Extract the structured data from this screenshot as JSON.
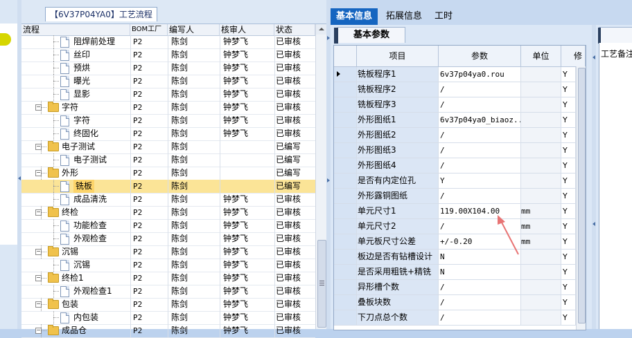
{
  "tree_panel": {
    "title": "【6V37P04YA0】工艺流程",
    "columns": {
      "flow": "流程",
      "bom": "BOM工厂",
      "writer": "编写人",
      "reviewer": "核审人",
      "status": "状态"
    },
    "rows": [
      {
        "level": 2,
        "type": "doc",
        "name": "阻焊前处理",
        "bom": "P2",
        "writer": "陈剑",
        "reviewer": "钟梦飞",
        "status": "已审核"
      },
      {
        "level": 2,
        "type": "doc",
        "name": "丝印",
        "bom": "P2",
        "writer": "陈剑",
        "reviewer": "钟梦飞",
        "status": "已审核"
      },
      {
        "level": 2,
        "type": "doc",
        "name": "预烘",
        "bom": "P2",
        "writer": "陈剑",
        "reviewer": "钟梦飞",
        "status": "已审核"
      },
      {
        "level": 2,
        "type": "doc",
        "name": "曝光",
        "bom": "P2",
        "writer": "陈剑",
        "reviewer": "钟梦飞",
        "status": "已审核"
      },
      {
        "level": 2,
        "type": "doc",
        "name": "显影",
        "bom": "P2",
        "writer": "陈剑",
        "reviewer": "钟梦飞",
        "status": "已审核"
      },
      {
        "level": 1,
        "type": "folder",
        "name": "字符",
        "bom": "P2",
        "writer": "陈剑",
        "reviewer": "钟梦飞",
        "status": "已审核"
      },
      {
        "level": 2,
        "type": "doc",
        "name": "字符",
        "bom": "P2",
        "writer": "陈剑",
        "reviewer": "钟梦飞",
        "status": "已审核"
      },
      {
        "level": 2,
        "type": "doc",
        "name": "终固化",
        "bom": "P2",
        "writer": "陈剑",
        "reviewer": "钟梦飞",
        "status": "已审核"
      },
      {
        "level": 1,
        "type": "folder",
        "name": "电子测试",
        "bom": "P2",
        "writer": "陈剑",
        "reviewer": "",
        "status": "已编写"
      },
      {
        "level": 2,
        "type": "doc",
        "name": "电子测试",
        "bom": "P2",
        "writer": "陈剑",
        "reviewer": "",
        "status": "已编写"
      },
      {
        "level": 1,
        "type": "folder",
        "name": "外形",
        "bom": "P2",
        "writer": "陈剑",
        "reviewer": "",
        "status": "已编写"
      },
      {
        "level": 2,
        "type": "doc",
        "name": "铣板",
        "bom": "P2",
        "writer": "陈剑",
        "reviewer": "",
        "status": "已编写",
        "selected": true
      },
      {
        "level": 2,
        "type": "doc",
        "name": "成品清洗",
        "bom": "P2",
        "writer": "陈剑",
        "reviewer": "钟梦飞",
        "status": "已审核"
      },
      {
        "level": 1,
        "type": "folder",
        "name": "终检",
        "bom": "P2",
        "writer": "陈剑",
        "reviewer": "钟梦飞",
        "status": "已审核"
      },
      {
        "level": 2,
        "type": "doc",
        "name": "功能检查",
        "bom": "P2",
        "writer": "陈剑",
        "reviewer": "钟梦飞",
        "status": "已审核"
      },
      {
        "level": 2,
        "type": "doc",
        "name": "外观检查",
        "bom": "P2",
        "writer": "陈剑",
        "reviewer": "钟梦飞",
        "status": "已审核"
      },
      {
        "level": 1,
        "type": "folder",
        "name": "沉锡",
        "bom": "P2",
        "writer": "陈剑",
        "reviewer": "钟梦飞",
        "status": "已审核"
      },
      {
        "level": 2,
        "type": "doc",
        "name": "沉锡",
        "bom": "P2",
        "writer": "陈剑",
        "reviewer": "钟梦飞",
        "status": "已审核"
      },
      {
        "level": 1,
        "type": "folder",
        "name": "终检1",
        "bom": "P2",
        "writer": "陈剑",
        "reviewer": "钟梦飞",
        "status": "已审核"
      },
      {
        "level": 2,
        "type": "doc",
        "name": "外观检查1",
        "bom": "P2",
        "writer": "陈剑",
        "reviewer": "钟梦飞",
        "status": "已审核"
      },
      {
        "level": 1,
        "type": "folder",
        "name": "包装",
        "bom": "P2",
        "writer": "陈剑",
        "reviewer": "钟梦飞",
        "status": "已审核"
      },
      {
        "level": 2,
        "type": "doc",
        "name": "内包装",
        "bom": "P2",
        "writer": "陈剑",
        "reviewer": "钟梦飞",
        "status": "已审核"
      },
      {
        "level": 1,
        "type": "folder",
        "name": "成品仓",
        "bom": "P2",
        "writer": "陈剑",
        "reviewer": "钟梦飞",
        "status": "已审核"
      }
    ]
  },
  "right_tabs": [
    "基本信息",
    "拓展信息",
    "工时"
  ],
  "sub_tab": "基本参数",
  "param_grid": {
    "columns": {
      "item": "项目",
      "param": "参数",
      "unit": "单位",
      "extra": "修"
    },
    "rows": [
      {
        "item": "铣板程序1",
        "param": "6v37p04ya0.rou",
        "unit": "",
        "flag": "Y"
      },
      {
        "item": "铣板程序2",
        "param": "/",
        "unit": "",
        "flag": "Y"
      },
      {
        "item": "铣板程序3",
        "param": "/",
        "unit": "",
        "flag": "Y"
      },
      {
        "item": "外形图纸1",
        "param": "6v37p04ya0_biaoz...",
        "unit": "",
        "flag": "Y"
      },
      {
        "item": "外形图纸2",
        "param": "/",
        "unit": "",
        "flag": "Y"
      },
      {
        "item": "外形图纸3",
        "param": "/",
        "unit": "",
        "flag": "Y"
      },
      {
        "item": "外形图纸4",
        "param": "/",
        "unit": "",
        "flag": "Y"
      },
      {
        "item": "是否有内定位孔",
        "param": "Y",
        "unit": "",
        "flag": "Y"
      },
      {
        "item": "外形露铜图纸",
        "param": "/",
        "unit": "",
        "flag": "Y"
      },
      {
        "item": "单元尺寸1",
        "param": "119.00X104.00",
        "unit": "mm",
        "flag": "Y"
      },
      {
        "item": "单元尺寸2",
        "param": "/",
        "unit": "mm",
        "flag": "Y"
      },
      {
        "item": "单元板尺寸公差",
        "param": "+/-0.20",
        "unit": "mm",
        "flag": "Y"
      },
      {
        "item": "板边是否有钻槽设计",
        "param": "N",
        "unit": "",
        "flag": "Y"
      },
      {
        "item": "是否采用粗铣+精铣",
        "param": "N",
        "unit": "",
        "flag": "Y"
      },
      {
        "item": "异形槽个数",
        "param": "/",
        "unit": "",
        "flag": "Y"
      },
      {
        "item": "叠板块数",
        "param": "/",
        "unit": "",
        "flag": "Y"
      },
      {
        "item": "下刀点总个数",
        "param": "/",
        "unit": "",
        "flag": "Y"
      }
    ]
  },
  "far_right": {
    "label": "工艺备注"
  },
  "colors": {
    "accent_tab": "#1565c0",
    "selected_row": "#fbe497",
    "folder": "#f0c24c",
    "annotation_arrow": "#e87474"
  }
}
